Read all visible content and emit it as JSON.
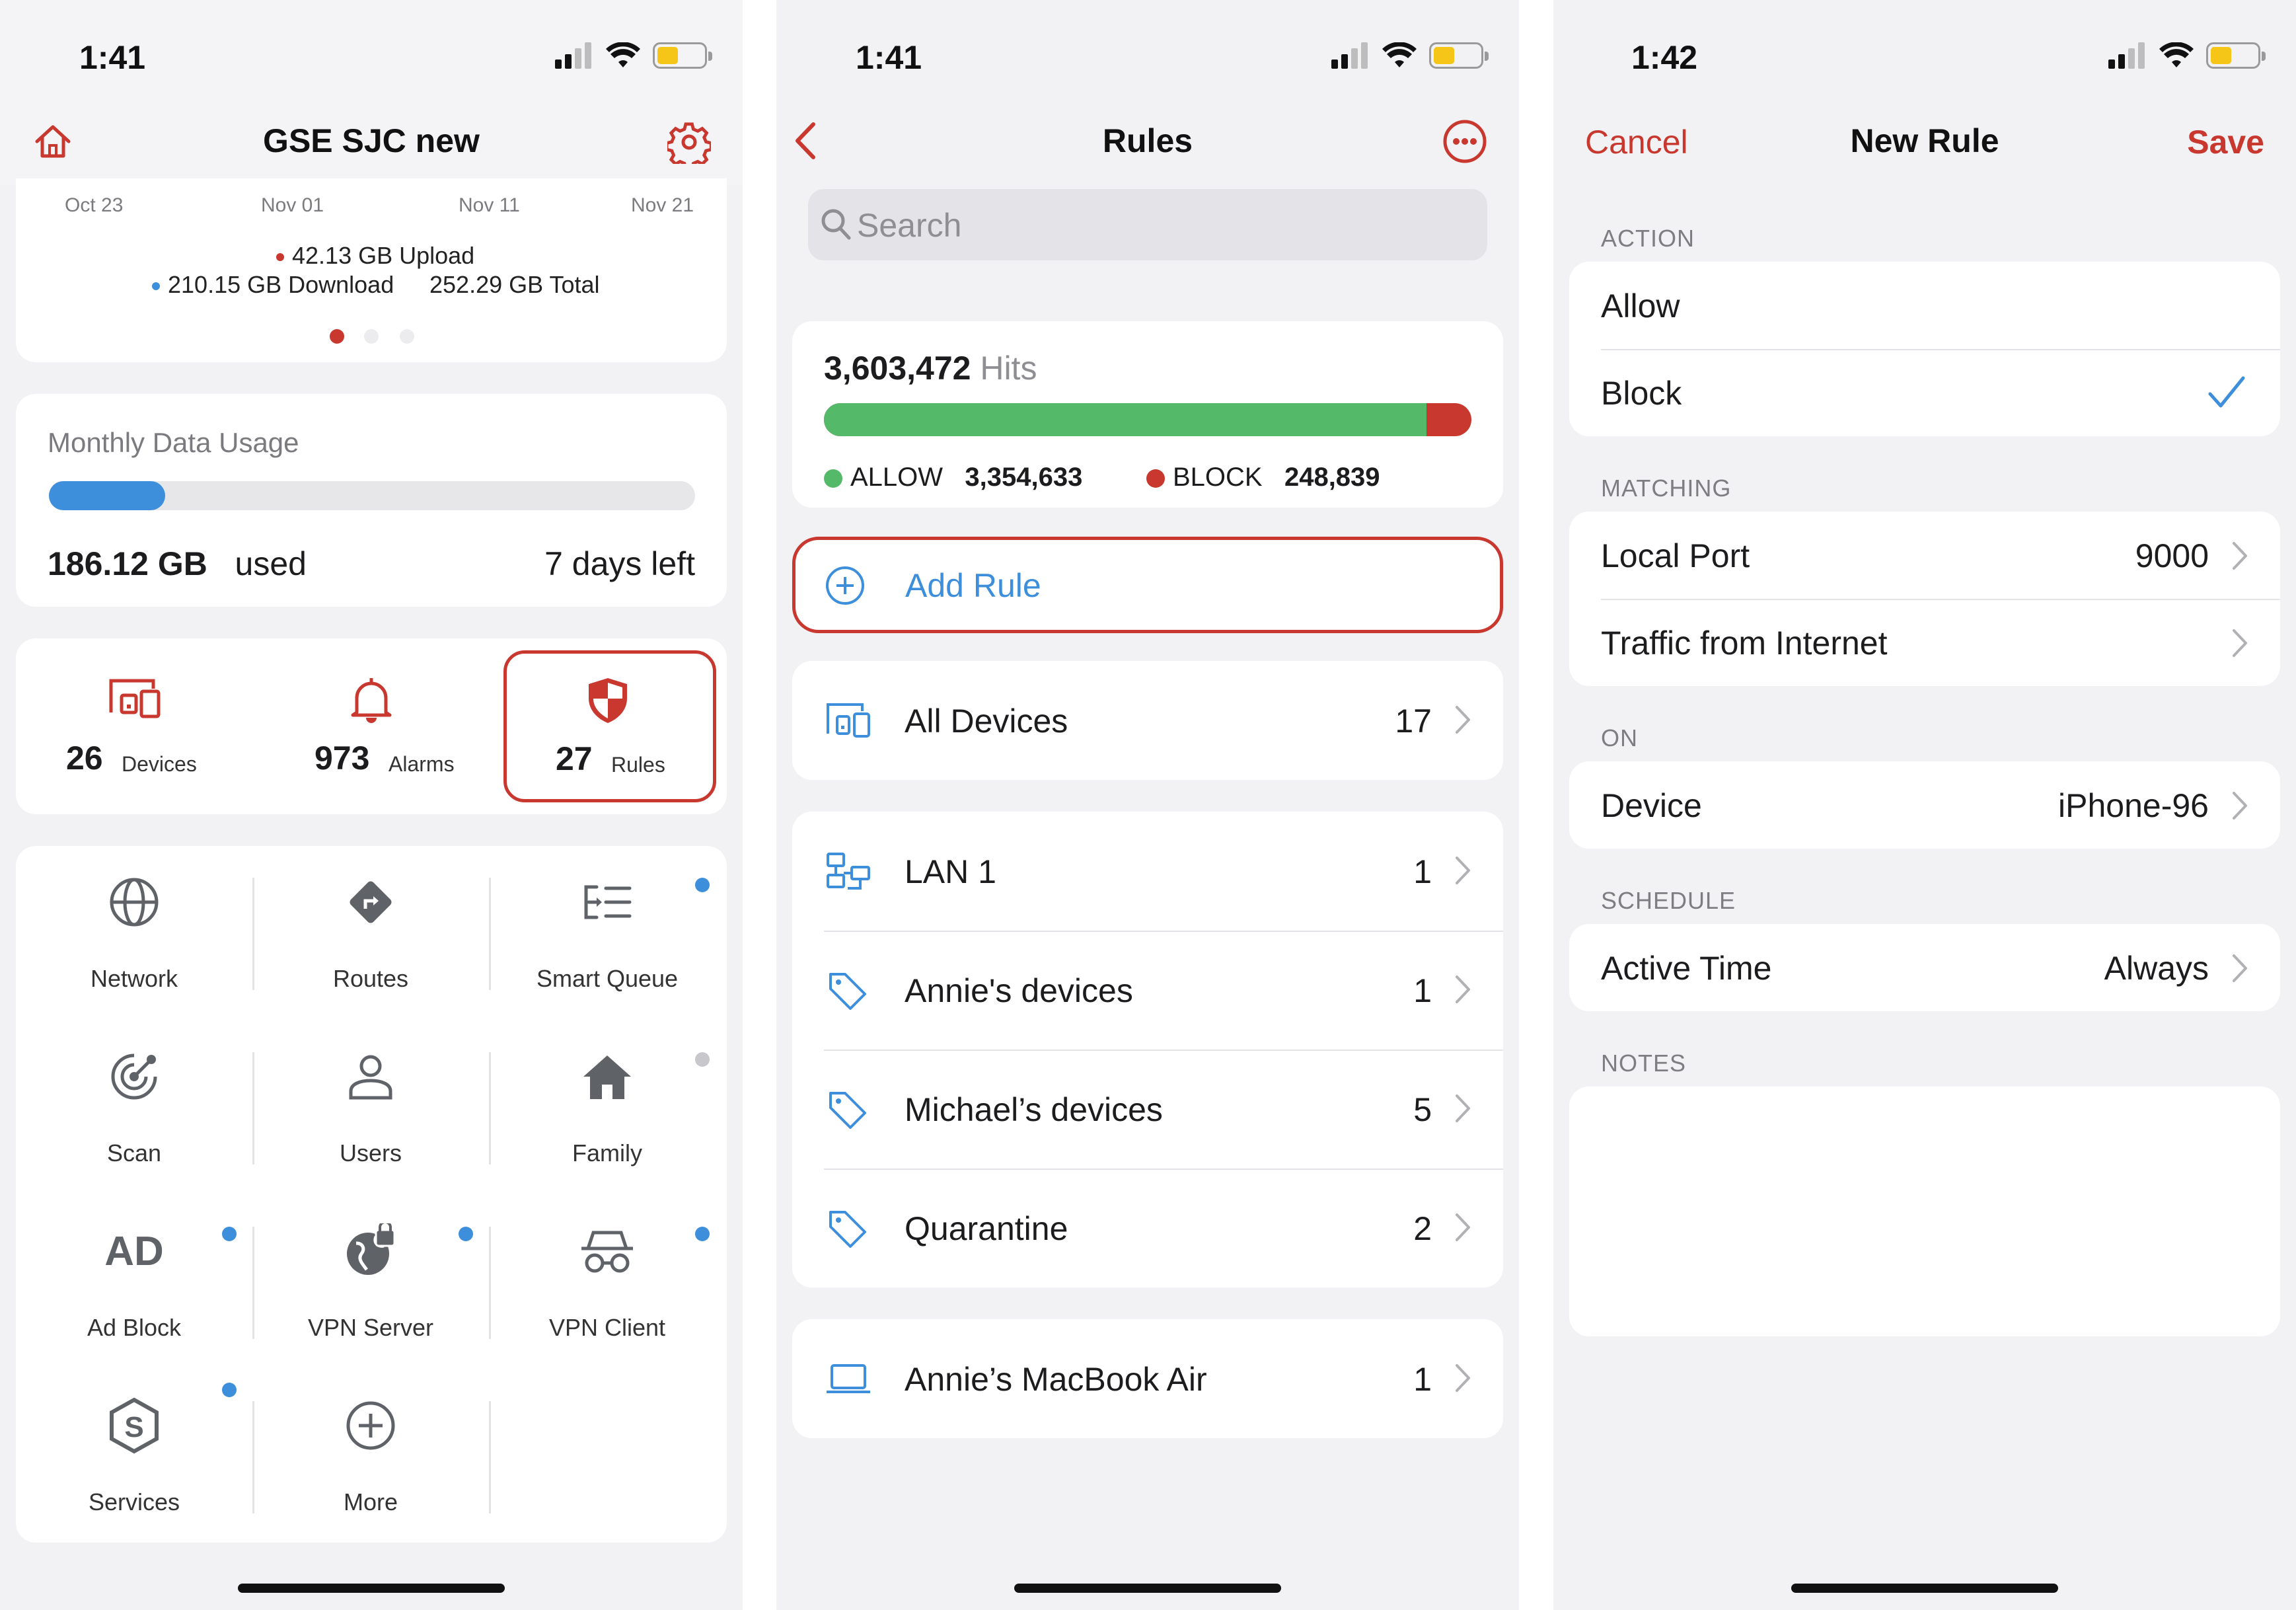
{
  "screen1": {
    "status": {
      "time": "1:41"
    },
    "nav": {
      "title": "GSE SJC new"
    },
    "chart": {
      "x_labels": [
        "Oct 23",
        "Nov 01",
        "Nov 11",
        "Nov 21"
      ],
      "upload": "42.13 GB Upload",
      "download": "210.15 GB Download",
      "total": "252.29 GB Total"
    },
    "usage": {
      "title": "Monthly Data Usage",
      "amount": "186.12 GB",
      "used_label": "used",
      "days_left": "7 days left",
      "progress": 0.18
    },
    "stats": [
      {
        "count": "26",
        "label": "Devices",
        "icon": "devices-icon"
      },
      {
        "count": "973",
        "label": "Alarms",
        "icon": "bell-icon"
      },
      {
        "count": "27",
        "label": "Rules",
        "icon": "shield-icon"
      }
    ],
    "tiles": [
      {
        "label": "Network",
        "icon": "globe-icon",
        "badge": ""
      },
      {
        "label": "Routes",
        "icon": "route-icon",
        "badge": ""
      },
      {
        "label": "Smart Queue",
        "icon": "smart-queue-icon",
        "badge": "#3d8fdb"
      },
      {
        "label": "Scan",
        "icon": "scan-icon",
        "badge": ""
      },
      {
        "label": "Users",
        "icon": "user-icon",
        "badge": ""
      },
      {
        "label": "Family",
        "icon": "house-icon",
        "badge": "#c8c8cc"
      },
      {
        "label": "Ad Block",
        "icon": "ad-block-icon",
        "icon_text": "AD",
        "badge": "#3d8fdb"
      },
      {
        "label": "VPN Server",
        "icon": "vpn-server-icon",
        "badge": "#3d8fdb"
      },
      {
        "label": "VPN Client",
        "icon": "vpn-client-icon",
        "badge": "#3d8fdb"
      },
      {
        "label": "Services",
        "icon": "services-icon",
        "badge": "#3d8fdb"
      },
      {
        "label": "More",
        "icon": "plus-circle-icon",
        "badge": ""
      }
    ]
  },
  "screen2": {
    "status": {
      "time": "1:41"
    },
    "nav": {
      "title": "Rules"
    },
    "search": {
      "placeholder": "Search"
    },
    "hits": {
      "count": "3,603,472",
      "label": "Hits",
      "allow_label": "ALLOW",
      "allow_count": "3,354,633",
      "block_label": "BLOCK",
      "block_count": "248,839",
      "allow_fraction": 0.931
    },
    "add_rule": "Add Rule",
    "all_devices": {
      "label": "All Devices",
      "count": "17"
    },
    "groups": [
      {
        "label": "LAN 1",
        "count": "1",
        "icon": "network-icon"
      },
      {
        "label": "Annie's devices",
        "count": "1",
        "icon": "tag-icon"
      },
      {
        "label": "Michael’s devices",
        "count": "5",
        "icon": "tag-icon"
      },
      {
        "label": "Quarantine",
        "count": "2",
        "icon": "tag-icon"
      }
    ],
    "device": {
      "label": "Annie’s MacBook Air",
      "count": "1"
    }
  },
  "screen3": {
    "status": {
      "time": "1:42"
    },
    "nav": {
      "title": "New Rule",
      "cancel": "Cancel",
      "save": "Save"
    },
    "action": {
      "title": "ACTION",
      "allow": "Allow",
      "block": "Block",
      "selected": "Block"
    },
    "matching": {
      "title": "MATCHING",
      "local_port_label": "Local Port",
      "local_port_value": "9000",
      "traffic_label": "Traffic from Internet"
    },
    "on": {
      "title": "ON",
      "device_label": "Device",
      "device_value": "iPhone-96"
    },
    "schedule": {
      "title": "SCHEDULE",
      "active_label": "Active Time",
      "active_value": "Always"
    },
    "notes": {
      "title": "NOTES"
    }
  },
  "colors": {
    "accent_red": "#c8382f",
    "accent_blue": "#3d8fdb",
    "allow_green": "#55b96a"
  }
}
